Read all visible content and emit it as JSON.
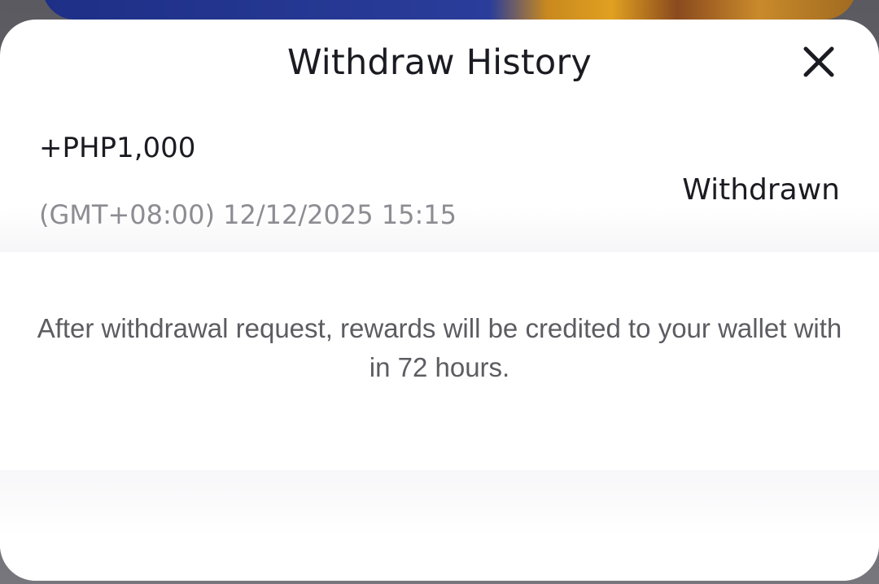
{
  "dialog": {
    "title": "Withdraw History",
    "close_icon": "close-icon"
  },
  "records": [
    {
      "amount": "+PHP1,000",
      "timestamp": "(GMT+08:00) 12/12/2025 15:15",
      "status": "Withdrawn"
    }
  ],
  "notice": "After withdrawal request, rewards will be credited to your wallet with in 72 hours."
}
